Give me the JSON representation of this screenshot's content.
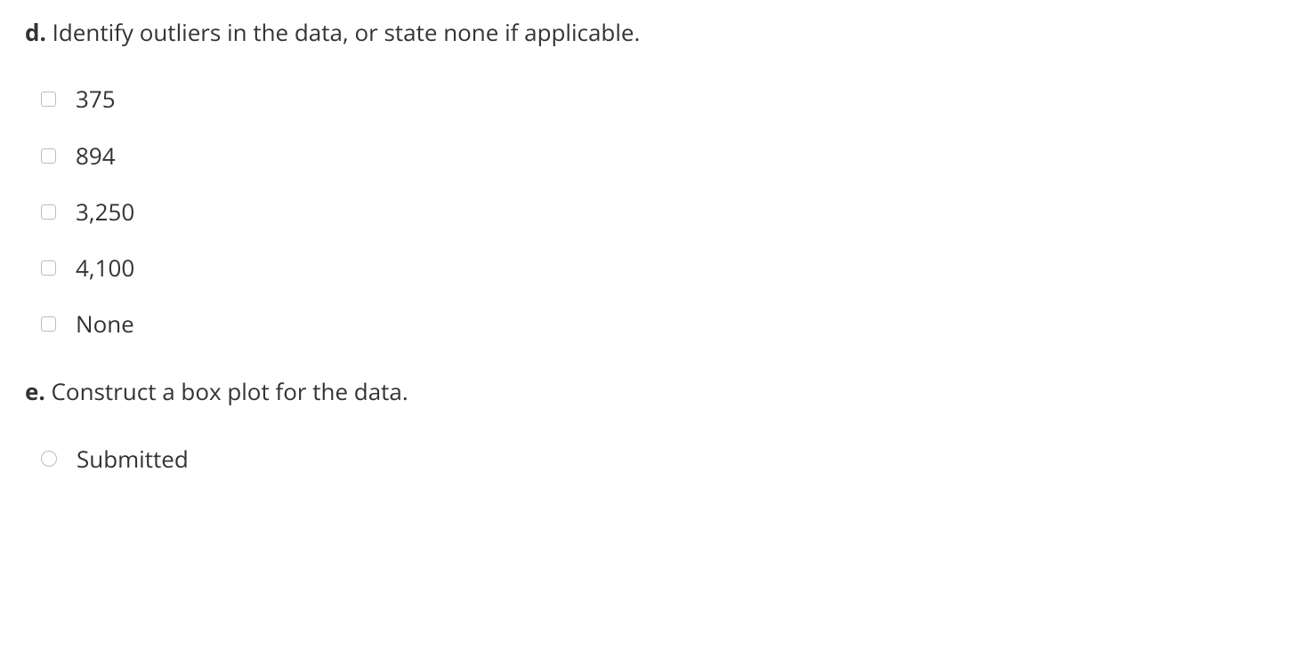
{
  "questions": [
    {
      "label": "d.",
      "prompt": "Identify outliers in the data, or state none if applicable.",
      "type": "checkbox",
      "options": [
        {
          "text": "375"
        },
        {
          "text": "894"
        },
        {
          "text": "3,250"
        },
        {
          "text": "4,100"
        },
        {
          "text": "None"
        }
      ]
    },
    {
      "label": "e.",
      "prompt": "Construct a box plot for the data.",
      "type": "radio",
      "options": [
        {
          "text": "Submitted"
        }
      ]
    }
  ]
}
